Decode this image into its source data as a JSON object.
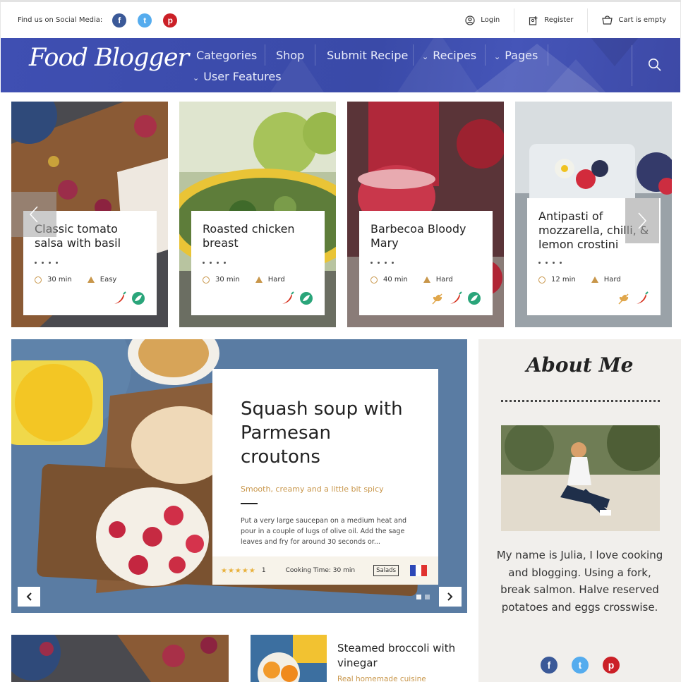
{
  "topbar": {
    "social_label": "Find us on Social Media:",
    "social": [
      {
        "name": "facebook",
        "glyph": "f",
        "color": "#3b5998"
      },
      {
        "name": "twitter",
        "glyph": "t",
        "color": "#55acee"
      },
      {
        "name": "pinterest",
        "glyph": "p",
        "color": "#cb2027"
      }
    ],
    "login": "Login",
    "register": "Register",
    "cart": "Cart is empty"
  },
  "nav": {
    "logo": "Food Blogger",
    "items": [
      "Categories",
      "Shop",
      "Submit Recipe",
      "Recipes",
      "Pages",
      "User Features"
    ],
    "dropdown_items": [
      "Recipes",
      "Pages",
      "User Features"
    ]
  },
  "cards": [
    {
      "title": "Classic tomato salsa with basil",
      "time": "30 min",
      "difficulty": "Easy",
      "tags": [
        "chili-icon",
        "leaf-icon"
      ]
    },
    {
      "title": "Roasted chicken breast",
      "time": "30 min",
      "difficulty": "Hard",
      "tags": [
        "chili-icon",
        "leaf-icon"
      ]
    },
    {
      "title": "Barbecoa Bloody Mary",
      "time": "40 min",
      "difficulty": "Hard",
      "tags": [
        "wheat-icon",
        "chili-icon",
        "leaf-icon"
      ]
    },
    {
      "title": "Antipasti of mozzarella, chilli, & lemon crostini",
      "time": "12 min",
      "difficulty": "Hard",
      "tags": [
        "wheat-icon",
        "chili-icon"
      ]
    }
  ],
  "hero": {
    "title": "Squash soup with Parmesan croutons",
    "subtitle": "Smooth, creamy and a little bit spicy",
    "description": "Put a very large saucepan on a medium heat and pour in a couple of lugs of olive oil. Add the sage leaves and fry for around 30 seconds or...",
    "stars": "★★★★★",
    "rating_count": "1",
    "cooking_time": "Cooking Time: 30 min",
    "category": "Salads",
    "flag_colors": [
      "#2d48b8",
      "#ffffff",
      "#e0322f"
    ],
    "slides": 2,
    "active_slide": 1
  },
  "about": {
    "title": "About Me",
    "text": "My name is Julia, I love cooking and blogging. Using a fork, break salmon. Halve reserved potatoes and eggs crosswise.",
    "social": [
      {
        "name": "facebook",
        "glyph": "f",
        "color": "#3b5998"
      },
      {
        "name": "twitter",
        "glyph": "t",
        "color": "#55acee"
      },
      {
        "name": "pinterest",
        "glyph": "p",
        "color": "#cb2027"
      }
    ]
  },
  "bottom": {
    "title": "Steamed broccoli with vinegar",
    "subtitle": "Real homemade cuisine"
  },
  "colors": {
    "nav": "#3f4fb2",
    "accent": "#c8964a",
    "chili": "#d6321f",
    "leaf": "#2aa57a",
    "wheat": "#e0a64a"
  }
}
